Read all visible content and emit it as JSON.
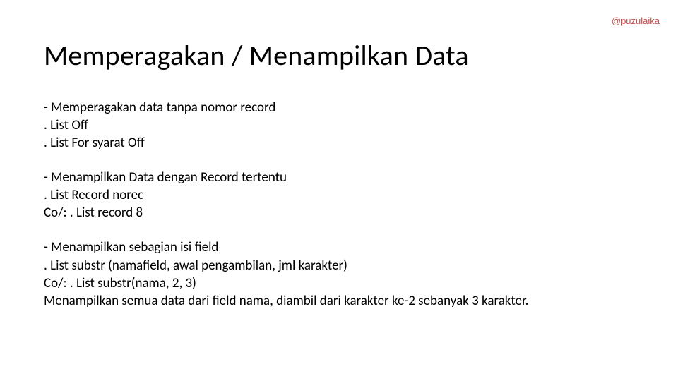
{
  "watermark": "@puzulaika",
  "title": "Memperagakan / Menampilkan Data",
  "sections": [
    {
      "lines": [
        "- Memperagakan data tanpa nomor record",
        ". List Off",
        ". List For syarat Off"
      ]
    },
    {
      "lines": [
        "- Menampilkan Data dengan Record tertentu",
        " . List Record norec",
        "Co/: . List record 8"
      ]
    },
    {
      "lines": [
        "- Menampilkan sebagian isi field",
        " . List substr (namafield, awal pengambilan, jml karakter)",
        "Co/: . List substr(nama, 2, 3)",
        "Menampilkan semua data dari field nama, diambil dari karakter ke-2 sebanyak 3 karakter."
      ]
    }
  ]
}
